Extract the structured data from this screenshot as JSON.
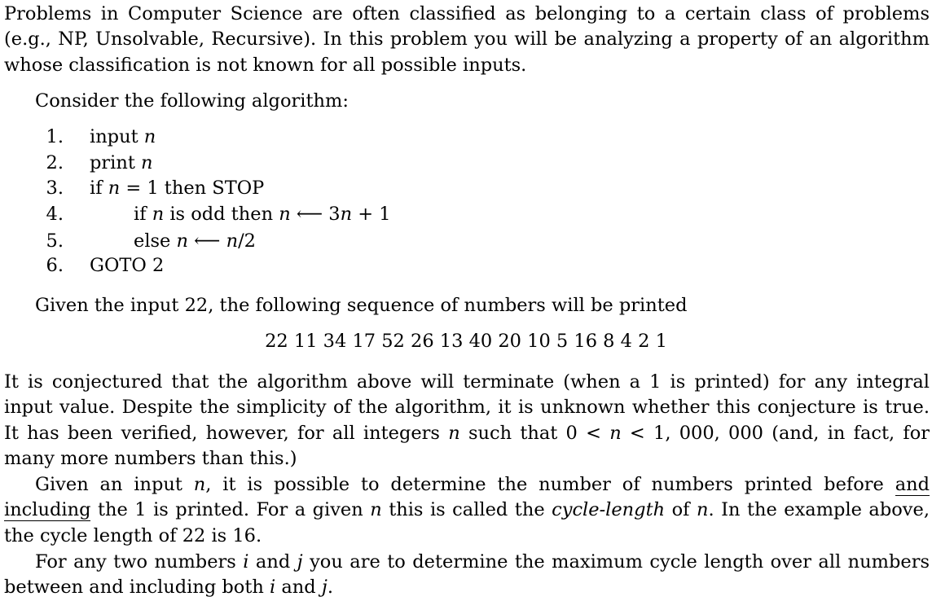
{
  "intro": {
    "text": "Problems in Computer Science are often classified as belonging to a certain class of problems (e.g., NP, Unsolvable, Recursive). In this problem you will be analyzing a property of an algorithm whose classification is not known for all possible inputs."
  },
  "consider": "Consider the following algorithm:",
  "algorithm": [
    {
      "num": "1.",
      "parts": [
        "input ",
        "n"
      ]
    },
    {
      "num": "2.",
      "parts": [
        "print ",
        "n"
      ]
    },
    {
      "num": "3.",
      "parts": [
        "if ",
        "n",
        " = 1 then STOP"
      ]
    },
    {
      "num": "4.",
      "parts": [
        "if ",
        "n",
        " is odd then ",
        "n",
        " ⟵ 3",
        "n",
        " + 1"
      ]
    },
    {
      "num": "5.",
      "parts": [
        "else ",
        "n",
        " ⟵ ",
        "n",
        "/2"
      ]
    },
    {
      "num": "6.",
      "parts": [
        "GOTO 2"
      ]
    }
  ],
  "given": "Given the input 22, the following sequence of numbers will be printed",
  "sequence": "22 11 34 17 52 26 13 40 20 10 5 16 8 4 2 1",
  "conjecture": {
    "p1": "It is conjectured that the algorithm above will terminate (when a 1 is printed) for any integral input value. Despite the simplicity of the algorithm, it is unknown whether this conjecture is true. It has been verified, however, for all integers ",
    "var": "n",
    "p2": " such that 0 < ",
    "var2": "n",
    "p3": " < 1, 000, 000 (and, in fact, for many more numbers than this.)"
  },
  "cycle": {
    "p1": "Given an input ",
    "var": "n",
    "p2": ", it is possible to determine the number of numbers printed before ",
    "underlined": "and including",
    "p3": " the 1 is printed. For a given ",
    "var2": "n",
    "p4": " this is called the ",
    "term": "cycle-length",
    "p5": " of ",
    "var3": "n",
    "p6": ". In the example above, the cycle length of 22 is 16."
  },
  "task": {
    "p1": "For any two numbers ",
    "i": "i",
    "p2": " and ",
    "j": "j",
    "p3": " you are to determine the maximum cycle length over all numbers between and including both ",
    "i2": "i",
    "p4": " and ",
    "j2": "j",
    "p5": "."
  }
}
